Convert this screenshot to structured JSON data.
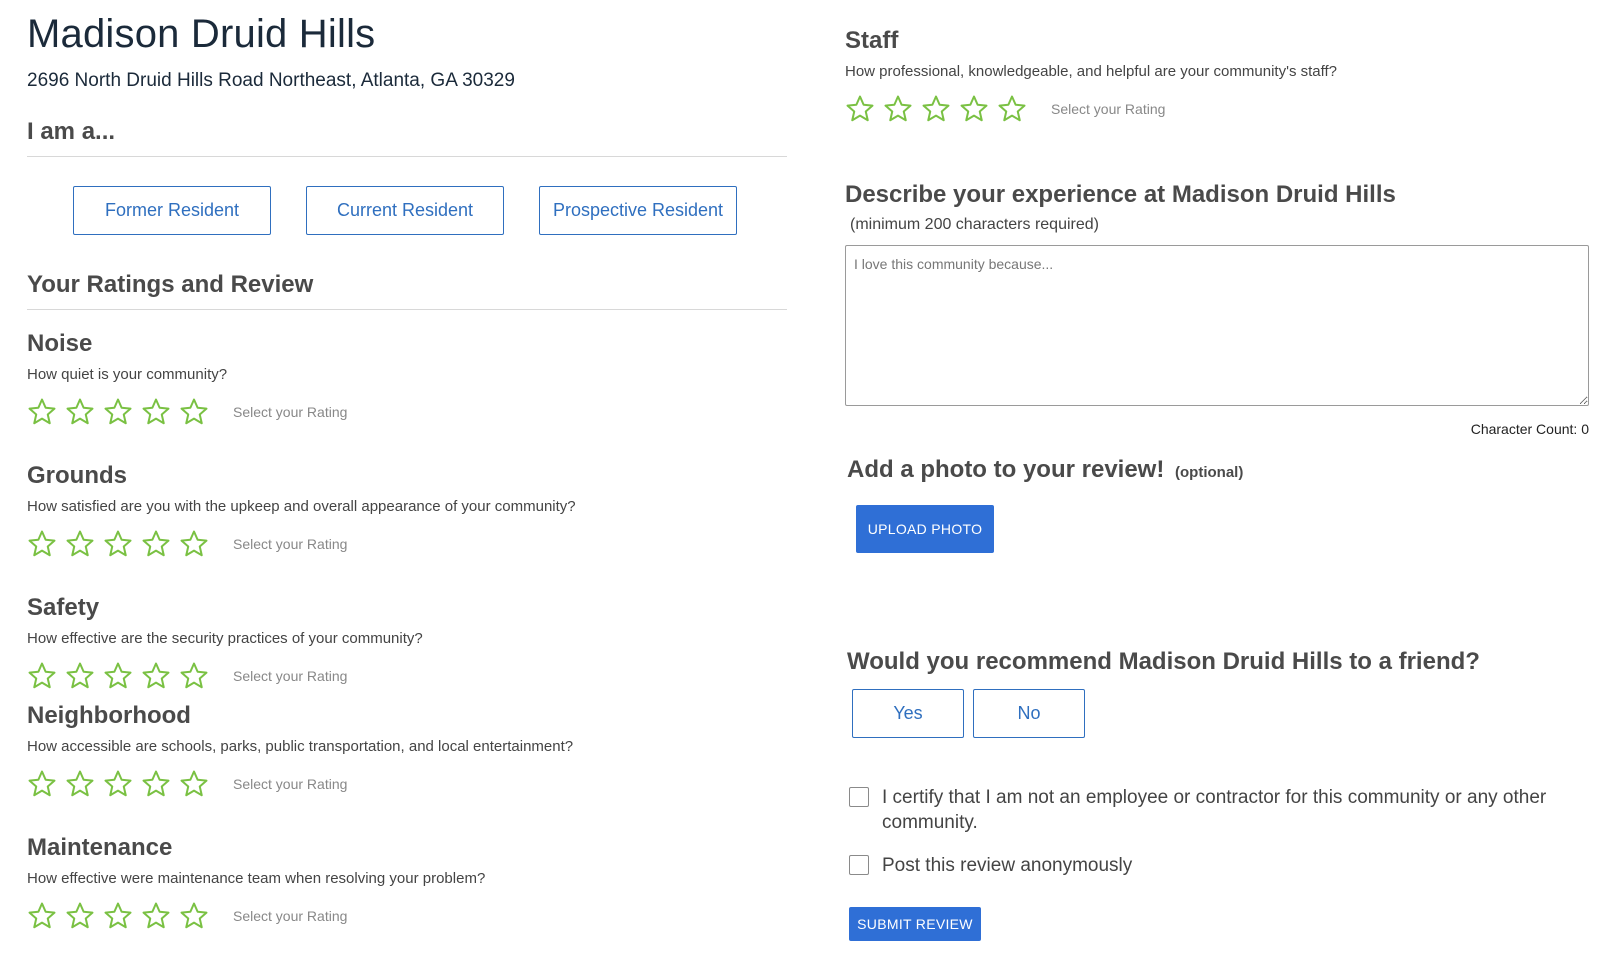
{
  "community": {
    "name": "Madison Druid Hills",
    "address": "2696 North Druid Hills Road Northeast, Atlanta, GA 30329"
  },
  "role": {
    "heading": "I am a...",
    "options": [
      "Former Resident",
      "Current Resident",
      "Prospective Resident"
    ]
  },
  "ratings_heading": "Your Ratings and Review",
  "star_icon": "star-outline-icon",
  "colors": {
    "star": "#7ac143",
    "accent_blue": "#2f6fbf",
    "button_blue": "#2f6fd6",
    "heading_gray": "#4a4a4a"
  },
  "ratings": [
    {
      "title": "Noise",
      "question": "How quiet is your community?",
      "hint": "Select your Rating"
    },
    {
      "title": "Grounds",
      "question": "How satisfied are you with the upkeep and overall appearance of your community?",
      "hint": "Select your Rating"
    },
    {
      "title": "Safety",
      "question": "How effective are the security practices of your community?",
      "hint": "Select your Rating"
    },
    {
      "title": "Neighborhood",
      "question": "How accessible are schools, parks, public transportation, and local entertainment?",
      "hint": "Select your Rating"
    },
    {
      "title": "Maintenance",
      "question": "How effective were maintenance team when resolving your problem?",
      "hint": "Select your Rating"
    }
  ],
  "staff": {
    "title": "Staff",
    "question": "How professional, knowledgeable, and helpful are your community's staff?",
    "hint": "Select your Rating"
  },
  "describe": {
    "title": "Describe your experience at Madison Druid Hills",
    "subtitle": "(minimum 200 characters required)",
    "placeholder": "I love this community because...",
    "value": "",
    "char_count": "Character Count: 0"
  },
  "photo": {
    "title": "Add a photo to your review!",
    "optional": "(optional)",
    "button": "UPLOAD PHOTO"
  },
  "recommend": {
    "title": "Would you recommend Madison Druid Hills to a friend?",
    "yes": "Yes",
    "no": "No"
  },
  "certify": {
    "label": "I certify that I am not an employee or contractor for this community or any other community.",
    "checked": false
  },
  "anonymous": {
    "label": "Post this review anonymously",
    "checked": false
  },
  "submit": "SUBMIT REVIEW"
}
